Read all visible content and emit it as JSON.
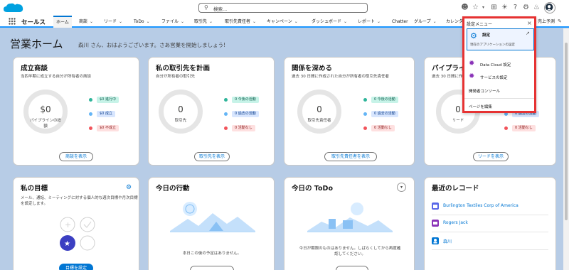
{
  "header": {
    "search_placeholder": "検索..."
  },
  "nav": {
    "app_name": "セールス",
    "tabs": [
      "ホーム",
      "商談",
      "リード",
      "ToDo",
      "ファイル",
      "取引先",
      "取引先責任者",
      "キャンペーン",
      "ダッシュボード",
      "レポート",
      "Chatter",
      "グループ",
      "カレンダ"
    ],
    "tail_tab": "売上予測"
  },
  "page": {
    "title": "営業ホーム",
    "greeting": "森川 さん、おはようございます。さあ営業を開始しましょう!"
  },
  "opp": {
    "title": "成立商談",
    "subtitle": "当四半期に成立する自分が所有者の商談",
    "ring_value": "$0",
    "ring_label": "パイプラインの総額",
    "pills": [
      "$0 進行中",
      "$0 成立",
      "$0 不成立"
    ],
    "button": "商談を表示"
  },
  "acct": {
    "title": "私の取引先を計画",
    "subtitle": "自分が所有者の取引先",
    "ring_value": "0",
    "ring_label": "取引先",
    "pills": [
      "0 今後の活動",
      "0 過去の活動",
      "0 活動なし"
    ],
    "button": "取引先を表示"
  },
  "contact": {
    "title": "関係を深める",
    "subtitle": "過去 30 日間に作成された自分が所有者の取引先責任者",
    "ring_value": "0",
    "ring_label": "取引先責任者",
    "pills": [
      "0 今後の活動",
      "0 過去の活動",
      "0 活動なし"
    ],
    "button": "取引先責任者を表示"
  },
  "pipe": {
    "title": "パイプライ",
    "subtitle": "過去 30 日間に作成",
    "ring_value": "0",
    "ring_label": "リード",
    "pills": [
      "0 過去の活動",
      "0 活動なし"
    ],
    "button": "リードを表示"
  },
  "goals": {
    "title": "私の目標",
    "desc": "メール、通話、ミーティングに対する個人的な週次目標や月次目標を設定します。",
    "button": "目標を設定"
  },
  "events": {
    "title": "今日の行動",
    "empty": "本日この後の予定はありません。"
  },
  "todo": {
    "title": "今日の ToDo",
    "empty": "今日が期限のものはありません。しばらくしてから再度確認してください。"
  },
  "recent": {
    "title": "最近のレコード",
    "items": [
      "Burlington Textiles Corp of America",
      "Rogers Jack",
      "森川"
    ]
  },
  "setup_menu": {
    "header": "設定メニュー",
    "setup_label": "設定",
    "setup_desc": "現在のアプリケーションの設定",
    "datacloud": "Data Cloud 設定",
    "service": "サービスの設定",
    "devconsole": "開発者コンソール",
    "edit_page": "ページを編集"
  },
  "colors": {
    "accent": "#0176d3",
    "highlight_border": "#e63232",
    "background": "#b7cce6"
  }
}
